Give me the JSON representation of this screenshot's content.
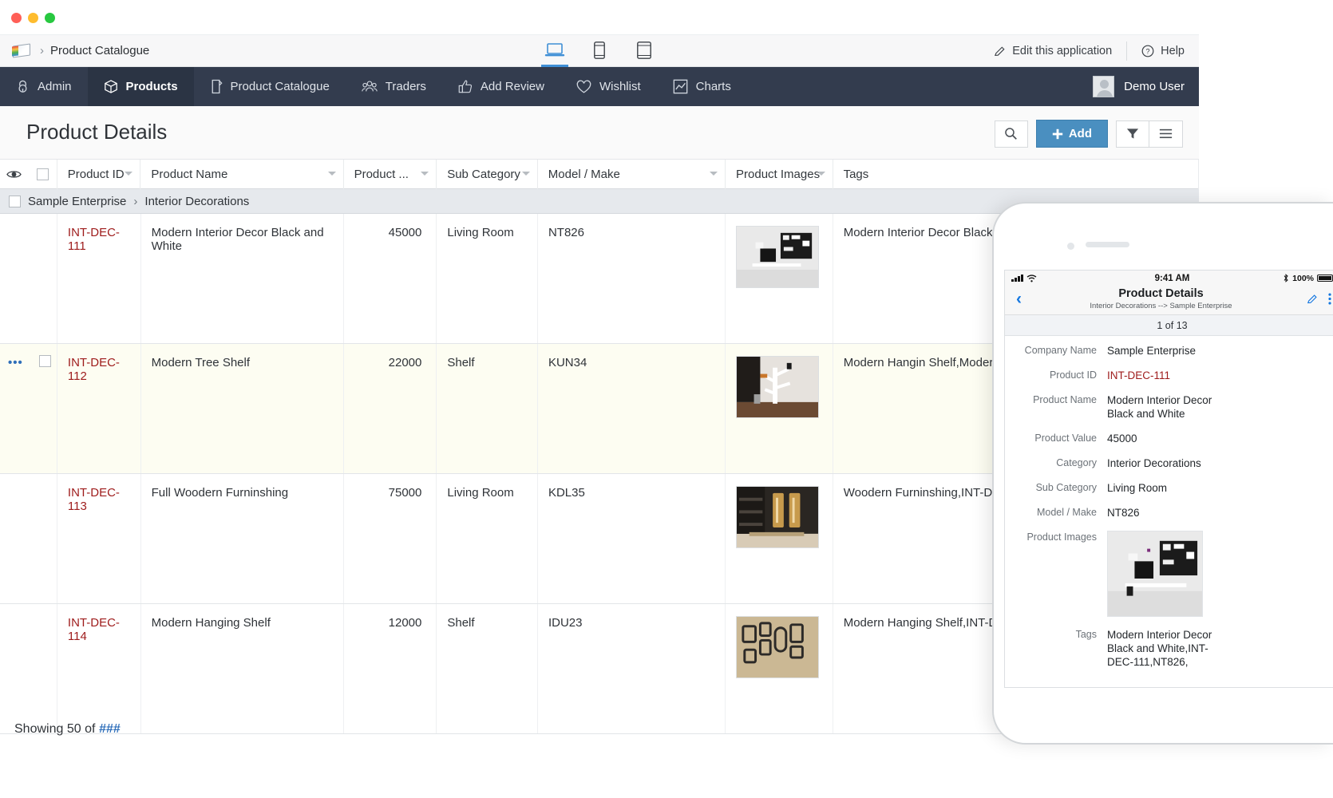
{
  "window": {
    "traffic_lights": [
      "close",
      "minimize",
      "zoom"
    ]
  },
  "appbar": {
    "logo_icon": "app-logo-icon",
    "breadcrumb_separator": "›",
    "breadcrumb": "Product Catalogue",
    "device_tabs": [
      {
        "icon": "laptop-icon",
        "name": "desktop",
        "active": true
      },
      {
        "icon": "mobile-phone-icon",
        "name": "phone",
        "active": false
      },
      {
        "icon": "tablet-icon",
        "name": "tablet",
        "active": false
      }
    ],
    "edit_label": "Edit this application",
    "edit_icon": "pencil-icon",
    "help_label": "Help",
    "help_icon": "question-circle-icon"
  },
  "nav": {
    "items": [
      {
        "label": "Admin",
        "icon": "lock-icon",
        "active": false
      },
      {
        "label": "Products",
        "icon": "cube-icon",
        "active": true
      },
      {
        "label": "Product Catalogue",
        "icon": "page-flag-icon",
        "active": false
      },
      {
        "label": "Traders",
        "icon": "people-group-icon",
        "active": false
      },
      {
        "label": "Add Review",
        "icon": "thumbs-up-icon",
        "active": false
      },
      {
        "label": "Wishlist",
        "icon": "heart-icon",
        "active": false
      },
      {
        "label": "Charts",
        "icon": "chart-icon",
        "active": false
      }
    ],
    "user": {
      "name": "Demo User",
      "avatar_icon": "avatar-icon"
    }
  },
  "page": {
    "title": "Product Details",
    "actions": {
      "search_icon": "search-icon",
      "add_label": "Add",
      "add_icon": "plus-icon",
      "filter_icon": "funnel-icon",
      "menu_icon": "hamburger-menu-icon"
    }
  },
  "table": {
    "columns": [
      {
        "label": "Product ID",
        "sortable": true
      },
      {
        "label": "Product Name",
        "sortable": true
      },
      {
        "label": "Product ...",
        "sortable": true
      },
      {
        "label": "Sub Category",
        "sortable": true
      },
      {
        "label": "Model / Make",
        "sortable": true
      },
      {
        "label": "Product Images",
        "sortable": true
      },
      {
        "label": "Tags",
        "sortable": false
      }
    ],
    "eye_icon": "eye-icon",
    "group": {
      "company": "Sample Enterprise",
      "separator": "›",
      "category": "Interior Decorations"
    },
    "rows": [
      {
        "product_id": "INT-DEC-111",
        "product_name": "Modern Interior Decor Black and White",
        "product_value": "45000",
        "sub_category": "Living Room",
        "model_make": "NT826",
        "image_alt": "modern-interior-decor-thumbnail",
        "tags": "Modern Interior Decor Black an",
        "highlighted": false,
        "has_row_menu": false
      },
      {
        "product_id": "INT-DEC-112",
        "product_name": "Modern Tree Shelf",
        "product_value": "22000",
        "sub_category": "Shelf",
        "model_make": "KUN34",
        "image_alt": "modern-tree-shelf-thumbnail",
        "tags": "Modern Hangin Shelf,Modern",
        "highlighted": true,
        "has_row_menu": true
      },
      {
        "product_id": "INT-DEC-113",
        "product_name": "Full Woodern Furninshing",
        "product_value": "75000",
        "sub_category": "Living Room",
        "model_make": "KDL35",
        "image_alt": "woodern-furnishing-thumbnail",
        "tags": "Woodern Furninshing,INT-DEC",
        "highlighted": false,
        "has_row_menu": false
      },
      {
        "product_id": "INT-DEC-114",
        "product_name": "Modern Hanging Shelf",
        "product_value": "12000",
        "sub_category": "Shelf",
        "model_make": "IDU23",
        "image_alt": "modern-hanging-shelf-thumbnail",
        "tags": "Modern Hanging Shelf,INT-DE",
        "highlighted": false,
        "has_row_menu": false
      }
    ],
    "footer": {
      "prefix": "Showing 50 of ",
      "count": "###"
    }
  },
  "phone": {
    "status": {
      "time": "9:41 AM",
      "battery": "100%",
      "bluetooth_icon": "bluetooth-icon",
      "signal_icon": "signal-bars-icon",
      "wifi_icon": "wifi-icon",
      "battery_icon": "battery-full-icon"
    },
    "nav": {
      "back_icon": "chevron-left-icon",
      "title": "Product Details",
      "subtitle": "Interior Decorations --> Sample Enterprise",
      "edit_icon": "pencil-icon",
      "more_icon": "kebab-menu-icon"
    },
    "counter": "1 of 13",
    "fields": [
      {
        "label": "Company Name",
        "value": "Sample Enterprise",
        "type": "text"
      },
      {
        "label": "Product ID",
        "value": "INT-DEC-111",
        "type": "id"
      },
      {
        "label": "Product Name",
        "value": "Modern Interior Decor Black and White",
        "type": "text"
      },
      {
        "label": "Product Value",
        "value": "45000",
        "type": "text"
      },
      {
        "label": "Category",
        "value": "Interior Decorations",
        "type": "text"
      },
      {
        "label": "Sub Category",
        "value": "Living Room",
        "type": "text"
      },
      {
        "label": "Model / Make",
        "value": "NT826",
        "type": "text"
      },
      {
        "label": "Product Images",
        "value": "modern-interior-decor-thumbnail",
        "type": "image"
      },
      {
        "label": "Tags",
        "value": "Modern Interior Decor Black and White,INT-DEC-111,NT826,",
        "type": "text"
      }
    ]
  },
  "colors": {
    "nav_bg": "#333c4e",
    "nav_active_bg": "#2b3444",
    "accent_blue": "#4a8fc0",
    "link_blue": "#2f6fba",
    "product_id_red": "#9e1b1b",
    "row_highlight": "#fdfdf2",
    "group_row_bg": "#e6e9ed",
    "ios_blue": "#1477e0"
  }
}
